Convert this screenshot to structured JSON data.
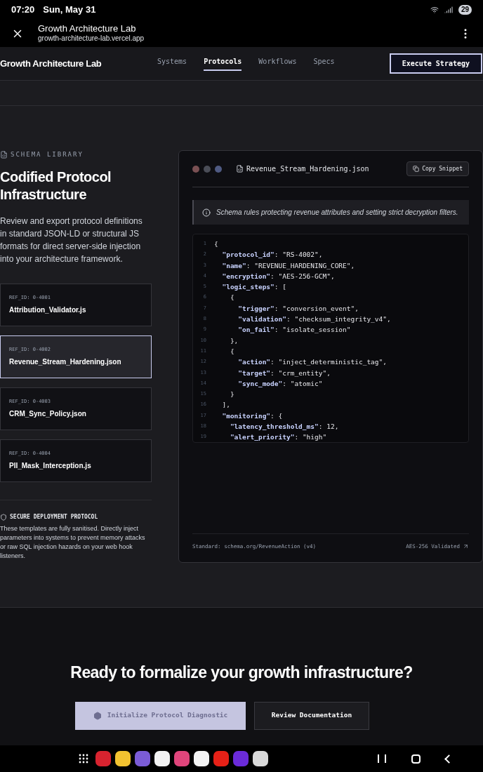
{
  "status_bar": {
    "time": "07:20",
    "date": "Sun, May 31",
    "battery": "29"
  },
  "browser": {
    "title": "Growth Architecture Lab",
    "url": "growth-architecture-lab.vercel.app"
  },
  "nav": {
    "brand": "Growth Architecture Lab",
    "links": [
      {
        "label": "Systems",
        "selected": false
      },
      {
        "label": "Protocols",
        "selected": true
      },
      {
        "label": "Workflows",
        "selected": false
      },
      {
        "label": "Specs",
        "selected": false
      }
    ],
    "cta": "Execute Strategy"
  },
  "library": {
    "eyebrow": "SCHEMA LIBRARY",
    "title": "Codified Protocol Infrastructure",
    "description": "Review and export protocol definitions in standard JSON-LD or structural JS formats for direct server-side injection into your architecture framework.",
    "items": [
      {
        "ref": "REF_ID: 0-4001",
        "name": "Attribution_Validator.js",
        "selected": false
      },
      {
        "ref": "REF_ID: 0-4002",
        "name": "Revenue_Stream_Hardening.json",
        "selected": true
      },
      {
        "ref": "REF_ID: 0-4003",
        "name": "CRM_Sync_Policy.json",
        "selected": false
      },
      {
        "ref": "REF_ID: 0-4004",
        "name": "PII_Mask_Interception.js",
        "selected": false
      }
    ],
    "notice_title": "SECURE DEPLOYMENT PROTOCOL",
    "notice_text": "These templates are fully sanitised. Directly inject parameters into systems to prevent memory attacks or raw SQL injection hazards on your web hook listeners."
  },
  "viewer": {
    "window_dots": [
      {
        "color": "#7a5053"
      },
      {
        "color": "#4a4d57"
      },
      {
        "color": "#4f5a82"
      }
    ],
    "filename": "Revenue_Stream_Hardening.json",
    "copy_button": "Copy Snippet",
    "info": "Schema rules protecting revenue attributes and setting strict decryption filters.",
    "code_lines": [
      {
        "number": "1",
        "text": "{"
      },
      {
        "number": "2",
        "text": "  \"protocol_id\": \"RS-4002\","
      },
      {
        "number": "3",
        "text": "  \"name\": \"REVENUE_HARDENING_CORE\","
      },
      {
        "number": "4",
        "text": "  \"encryption\": \"AES-256-GCM\","
      },
      {
        "number": "5",
        "text": "  \"logic_steps\": ["
      },
      {
        "number": "6",
        "text": "    {"
      },
      {
        "number": "7",
        "text": "      \"trigger\": \"conversion_event\","
      },
      {
        "number": "8",
        "text": "      \"validation\": \"checksum_integrity_v4\","
      },
      {
        "number": "9",
        "text": "      \"on_fail\": \"isolate_session\""
      },
      {
        "number": "10",
        "text": "    },"
      },
      {
        "number": "11",
        "text": "    {"
      },
      {
        "number": "12",
        "text": "      \"action\": \"inject_deterministic_tag\","
      },
      {
        "number": "13",
        "text": "      \"target\": \"crm_entity\","
      },
      {
        "number": "14",
        "text": "      \"sync_mode\": \"atomic\""
      },
      {
        "number": "15",
        "text": "    }"
      },
      {
        "number": "16",
        "text": "  ],"
      },
      {
        "number": "17",
        "text": "  \"monitoring\": {"
      },
      {
        "number": "18",
        "text": "    \"latency_threshold_ms\": 12,"
      },
      {
        "number": "19",
        "text": "    \"alert_priority\": \"high\""
      }
    ],
    "footer_left": "Standard: schema.org/RevenueAction (v4)",
    "footer_right": "AES-256 Validated"
  },
  "cta_section": {
    "heading": "Ready to formalize your growth infrastructure?",
    "primary": {
      "label": "Initialize Protocol Diagnostic",
      "disabled": true
    },
    "secondary": "Review Documentation"
  },
  "dock": {
    "apps": [
      {
        "color": "#d8232f"
      },
      {
        "color": "#f2c230"
      },
      {
        "color": "#7b5cd6"
      },
      {
        "color": "#f2f2f2"
      },
      {
        "color": "#e0457b"
      },
      {
        "color": "#f2f2f2"
      },
      {
        "color": "#e62117"
      },
      {
        "color": "#6a2bd9"
      },
      {
        "color": "#d9d9d9"
      }
    ]
  }
}
